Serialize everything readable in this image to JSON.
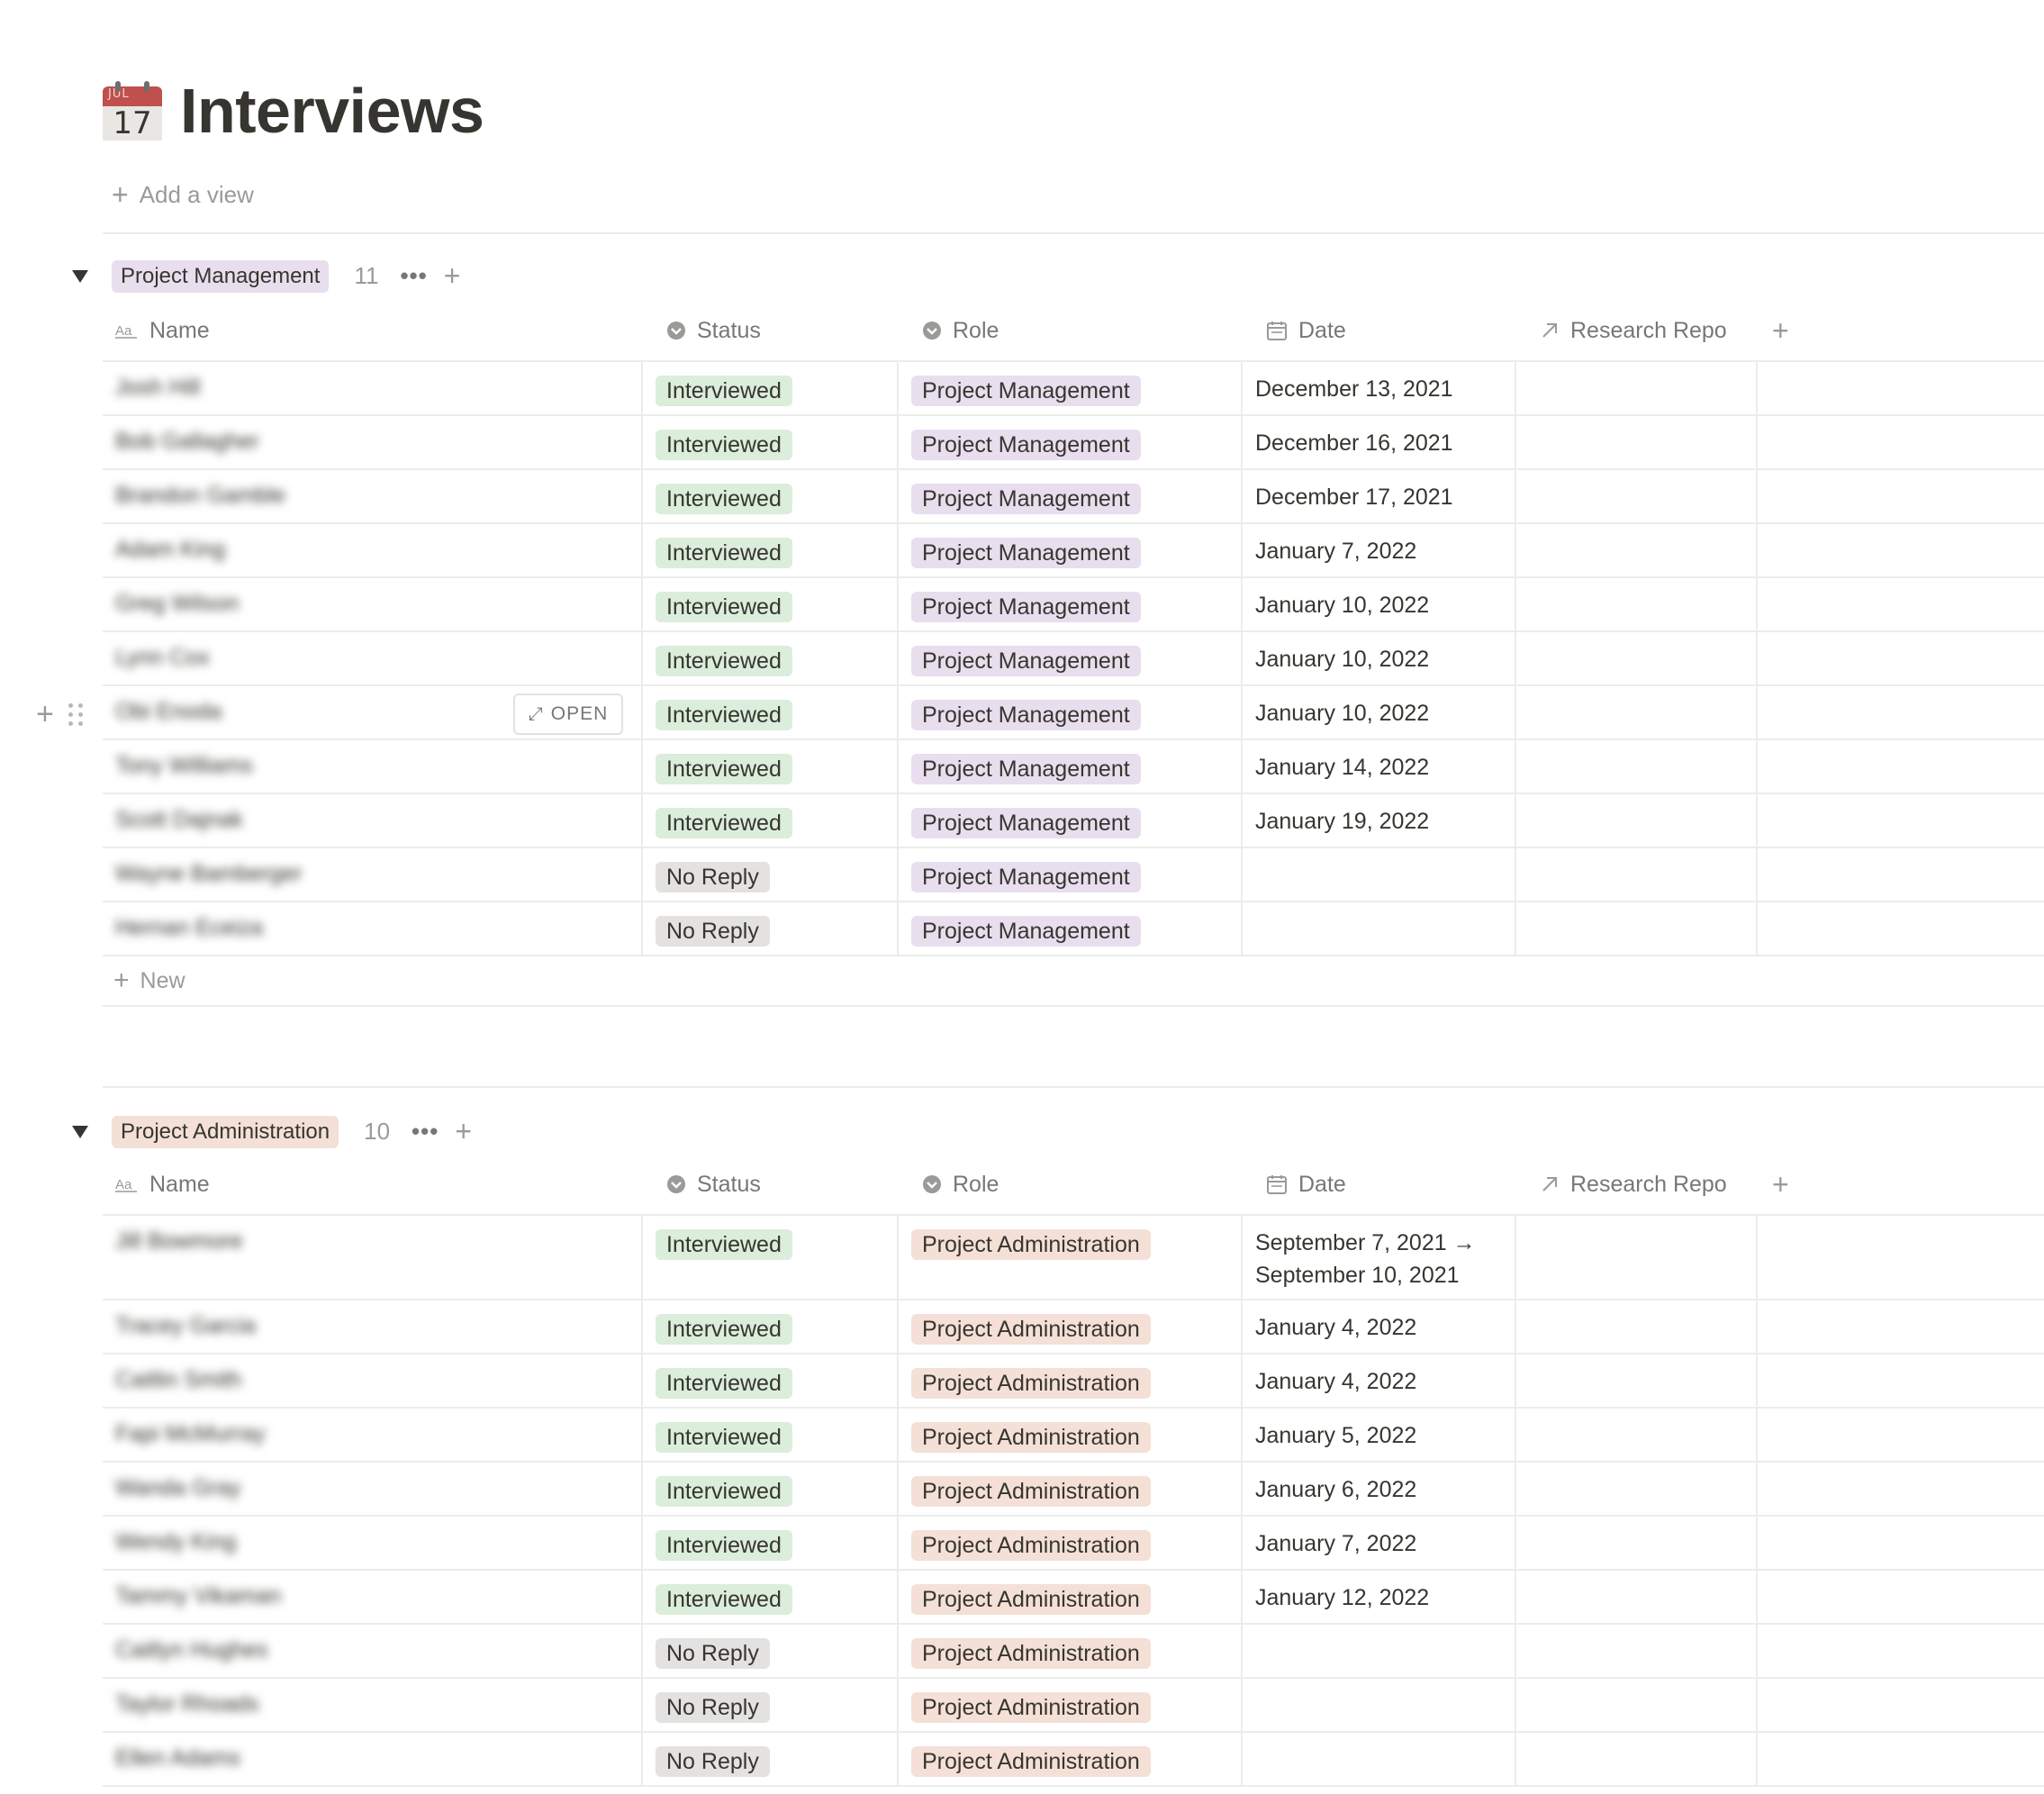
{
  "page": {
    "title": "Interviews",
    "icon": "calendar-17-icon",
    "icon_month": "JUL",
    "icon_day": "17"
  },
  "add_view_label": "Add a view",
  "new_label": "New",
  "open_label": "OPEN",
  "columns": {
    "name": "Name",
    "status": "Status",
    "role": "Role",
    "date": "Date",
    "repo": "Research Repo"
  },
  "groups": [
    {
      "label": "Project Management",
      "count": "11",
      "rows": [
        {
          "name": "Josh Hill",
          "status": "Interviewed",
          "role": "Project Management",
          "date": "December 13, 2021"
        },
        {
          "name": "Bob Gallagher",
          "status": "Interviewed",
          "role": "Project Management",
          "date": "December 16, 2021"
        },
        {
          "name": "Brandon Gamble",
          "status": "Interviewed",
          "role": "Project Management",
          "date": "December 17, 2021"
        },
        {
          "name": "Adam King",
          "status": "Interviewed",
          "role": "Project Management",
          "date": "January 7, 2022"
        },
        {
          "name": "Greg Wilson",
          "status": "Interviewed",
          "role": "Project Management",
          "date": "January 10, 2022"
        },
        {
          "name": "Lynn Cox",
          "status": "Interviewed",
          "role": "Project Management",
          "date": "January 10, 2022"
        },
        {
          "name": "Obi Enoda",
          "status": "Interviewed",
          "role": "Project Management",
          "date": "January 10, 2022"
        },
        {
          "name": "Tony Williams",
          "status": "Interviewed",
          "role": "Project Management",
          "date": "January 14, 2022"
        },
        {
          "name": "Scott Dajnak",
          "status": "Interviewed",
          "role": "Project Management",
          "date": "January 19, 2022"
        },
        {
          "name": "Wayne Bamberger",
          "status": "No Reply",
          "role": "Project Management",
          "date": ""
        },
        {
          "name": "Hernan Eceiza",
          "status": "No Reply",
          "role": "Project Management",
          "date": ""
        }
      ]
    },
    {
      "label": "Project Administration",
      "count": "10",
      "rows": [
        {
          "name": "Jill Bowmore",
          "status": "Interviewed",
          "role": "Project Administration",
          "date": "September 7, 2021 →",
          "date2": "September 10, 2021"
        },
        {
          "name": "Tracey Garcia",
          "status": "Interviewed",
          "role": "Project Administration",
          "date": "January 4, 2022"
        },
        {
          "name": "Caitlin Smith",
          "status": "Interviewed",
          "role": "Project Administration",
          "date": "January 4, 2022"
        },
        {
          "name": "Fapi McMurray",
          "status": "Interviewed",
          "role": "Project Administration",
          "date": "January 5, 2022"
        },
        {
          "name": "Wanda Gray",
          "status": "Interviewed",
          "role": "Project Administration",
          "date": "January 6, 2022"
        },
        {
          "name": "Wendy King",
          "status": "Interviewed",
          "role": "Project Administration",
          "date": "January 7, 2022"
        },
        {
          "name": "Tammy Vikaman",
          "status": "Interviewed",
          "role": "Project Administration",
          "date": "January 12, 2022"
        },
        {
          "name": "Caitlyn Hughes",
          "status": "No Reply",
          "role": "Project Administration",
          "date": ""
        },
        {
          "name": "Taylor Rhoads",
          "status": "No Reply",
          "role": "Project Administration",
          "date": ""
        },
        {
          "name": "Ellen Adams",
          "status": "No Reply",
          "role": "Project Administration",
          "date": ""
        }
      ]
    }
  ],
  "colors": {
    "interviewed": "#dbeddb",
    "no_reply": "#e3e2e0",
    "project_management": "#e8deee",
    "project_administration": "#f4e0d6",
    "text": "#37352f",
    "muted": "#9b9a97"
  }
}
